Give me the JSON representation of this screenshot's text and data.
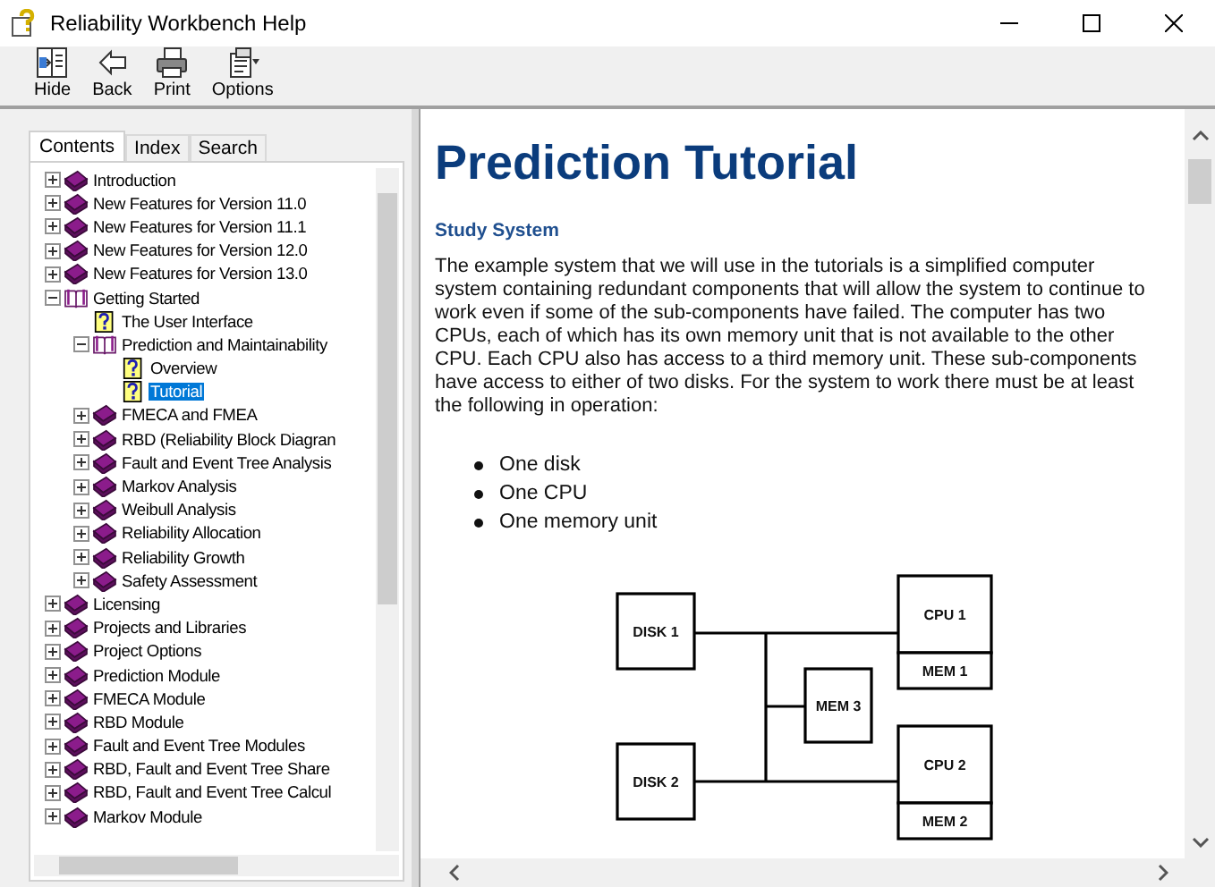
{
  "window": {
    "title": "Reliability Workbench Help"
  },
  "toolbar": [
    {
      "label": "Hide",
      "kind": "hide"
    },
    {
      "label": "Back",
      "kind": "back"
    },
    {
      "label": "Print",
      "kind": "print"
    },
    {
      "label": "Options",
      "kind": "options"
    }
  ],
  "tabs": [
    {
      "label": "Contents",
      "selected": true
    },
    {
      "label": "Index",
      "selected": false
    },
    {
      "label": "Search",
      "selected": false
    }
  ],
  "tree": {
    "items": [
      {
        "label": "Introduction",
        "kind": "book",
        "expanded": false,
        "selected": false
      },
      {
        "label": "New Features for Version 11.0",
        "kind": "book",
        "expanded": false,
        "selected": false
      },
      {
        "label": "New Features for Version 11.1",
        "kind": "book",
        "expanded": false,
        "selected": false
      },
      {
        "label": "New Features for Version 12.0",
        "kind": "book",
        "expanded": false,
        "selected": false
      },
      {
        "label": "New Features for Version 13.0",
        "kind": "book",
        "expanded": false,
        "selected": false
      },
      {
        "label": "Getting Started",
        "kind": "book",
        "expanded": true,
        "selected": false,
        "children": [
          {
            "label": "The User Interface",
            "kind": "page",
            "selected": false
          },
          {
            "label": "Prediction and Maintainability",
            "kind": "book",
            "expanded": true,
            "selected": false,
            "children": [
              {
                "label": "Overview",
                "kind": "page",
                "selected": false
              },
              {
                "label": "Tutorial",
                "kind": "page",
                "selected": true
              }
            ]
          },
          {
            "label": "FMECA and FMEA",
            "kind": "book",
            "expanded": false,
            "selected": false
          },
          {
            "label": "RBD (Reliability Block Diagran",
            "kind": "book",
            "expanded": false,
            "selected": false
          },
          {
            "label": "Fault and Event Tree Analysis",
            "kind": "book",
            "expanded": false,
            "selected": false
          },
          {
            "label": "Markov Analysis",
            "kind": "book",
            "expanded": false,
            "selected": false
          },
          {
            "label": "Weibull Analysis",
            "kind": "book",
            "expanded": false,
            "selected": false
          },
          {
            "label": "Reliability Allocation",
            "kind": "book",
            "expanded": false,
            "selected": false
          },
          {
            "label": "Reliability Growth",
            "kind": "book",
            "expanded": false,
            "selected": false
          },
          {
            "label": "Safety Assessment",
            "kind": "book",
            "expanded": false,
            "selected": false
          }
        ]
      },
      {
        "label": "Licensing",
        "kind": "book",
        "expanded": false,
        "selected": false
      },
      {
        "label": "Projects and Libraries",
        "kind": "book",
        "expanded": false,
        "selected": false
      },
      {
        "label": "Project Options",
        "kind": "book",
        "expanded": false,
        "selected": false
      },
      {
        "label": "Prediction Module",
        "kind": "book",
        "expanded": false,
        "selected": false
      },
      {
        "label": "FMECA Module",
        "kind": "book",
        "expanded": false,
        "selected": false
      },
      {
        "label": "RBD Module",
        "kind": "book",
        "expanded": false,
        "selected": false
      },
      {
        "label": "Fault and Event Tree Modules",
        "kind": "book",
        "expanded": false,
        "selected": false
      },
      {
        "label": "RBD, Fault and Event Tree Share",
        "kind": "book",
        "expanded": false,
        "selected": false
      },
      {
        "label": "RBD, Fault and Event Tree Calcul",
        "kind": "book",
        "expanded": false,
        "selected": false
      },
      {
        "label": "Markov Module",
        "kind": "book",
        "expanded": false,
        "selected": false
      }
    ]
  },
  "article": {
    "title": "Prediction Tutorial",
    "heading": "Study System",
    "paragraph": "The example system that we will use in the tutorials is a simplified computer system containing redundant components that will allow the system to continue to work even if some of the sub-components have failed. The computer has two CPUs, each of which has its own memory unit that is not available to the other CPU. Each CPU also has access to a third memory unit. These sub-components have access to either of two disks. For the system to work there must be at least the following in operation:",
    "bullets": [
      "One disk",
      "One CPU",
      "One memory unit"
    ],
    "diagram": {
      "blocks": [
        {
          "label": "DISK 1"
        },
        {
          "label": "DISK 2"
        },
        {
          "label": "MEM 3"
        },
        {
          "label": "CPU 1"
        },
        {
          "label": "MEM 1"
        },
        {
          "label": "CPU 2"
        },
        {
          "label": "MEM 2"
        }
      ]
    }
  }
}
